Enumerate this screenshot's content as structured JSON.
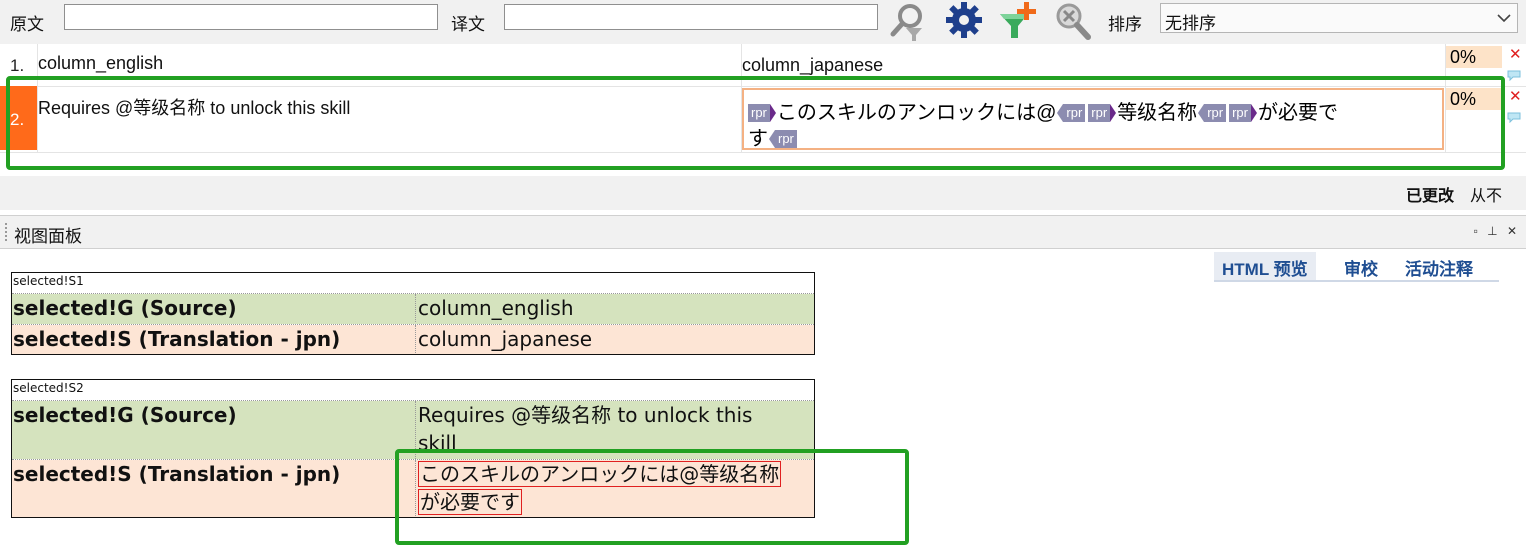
{
  "toolbar": {
    "source_label": "原文",
    "source_value": "",
    "target_label": "译文",
    "target_value": "",
    "icons": [
      "search-icon",
      "settings-gear-icon",
      "add-filter-icon",
      "clear-search-icon"
    ],
    "sort_label": "排序",
    "sort_value": "无排序"
  },
  "grid": {
    "rows": [
      {
        "num": "1.",
        "source": "column_english",
        "target": "column_japanese",
        "match": "0%"
      },
      {
        "num": "2.",
        "source": "Requires @等级名称 to unlock this skill",
        "match": "0%",
        "target_line1": {
          "t1": "このスキルのアンロックには@",
          "t2": "等级名称",
          "t3": "が必要で"
        },
        "target_line2": {
          "t1": "す"
        },
        "tag_label": "rpr"
      }
    ]
  },
  "status": {
    "changed": "已更改",
    "never": "从不"
  },
  "panel": {
    "title": "视图面板",
    "buttons": "▫ ⊥ ✕",
    "tabs": [
      "HTML 预览",
      "审校",
      "活动注释"
    ],
    "tables": [
      {
        "caption": "selected!S1",
        "source_label": "selected!G (Source)",
        "source_value": "column_english",
        "target_label": "selected!S (Translation - jpn)",
        "target_value": "column_japanese"
      },
      {
        "caption": "selected!S2",
        "source_label": "selected!G (Source)",
        "source_value_1": "Requires @等级名称 to unlock this",
        "source_value_2": "skill",
        "target_label": "selected!S (Translation - jpn)",
        "target_value_1": "このスキルのアンロックには@等级名称",
        "target_value_2": "が必要です"
      }
    ]
  },
  "colors": {
    "active_row": "#ff6a1a",
    "highlight_box": "#22a022",
    "source_row_bg": "#d5e3be",
    "target_row_bg": "#fde5d5",
    "tag_bg": "#8c8cb0",
    "tab_text": "#1f4e92"
  }
}
